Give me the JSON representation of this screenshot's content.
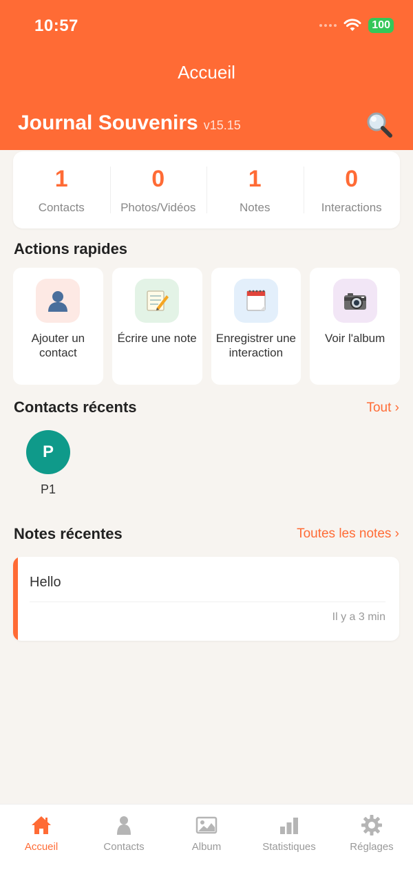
{
  "status_bar": {
    "time": "10:57",
    "battery": "100"
  },
  "header": {
    "nav_title": "Accueil",
    "app_title": "Journal Souvenirs",
    "version": "v15.15",
    "search_icon": "magnifier-icon"
  },
  "stats": [
    {
      "value": "1",
      "label": "Contacts"
    },
    {
      "value": "0",
      "label": "Photos/Vidéos"
    },
    {
      "value": "1",
      "label": "Notes"
    },
    {
      "value": "0",
      "label": "Interactions"
    }
  ],
  "quick_actions": {
    "title": "Actions rapides",
    "items": [
      {
        "label": "Ajouter un contact",
        "icon": "person-icon",
        "bg": "#fde9e4"
      },
      {
        "label": "Écrire une note",
        "icon": "memo-icon",
        "bg": "#e3f3e6"
      },
      {
        "label": "Enregistrer une interaction",
        "icon": "calendar-icon",
        "bg": "#e3effb"
      },
      {
        "label": "Voir l'album",
        "icon": "camera-icon",
        "bg": "#f2e6f6"
      }
    ]
  },
  "recent_contacts": {
    "title": "Contacts récents",
    "link": "Tout ›",
    "items": [
      {
        "initial": "P",
        "name": "P1",
        "color": "#0f9a8a"
      }
    ]
  },
  "recent_notes": {
    "title": "Notes récentes",
    "link": "Toutes les notes ›",
    "items": [
      {
        "text": "Hello",
        "time": "Il y a 3 min"
      }
    ]
  },
  "tabbar": [
    {
      "label": "Accueil",
      "icon": "home-icon",
      "active": true
    },
    {
      "label": "Contacts",
      "icon": "contacts-icon",
      "active": false
    },
    {
      "label": "Album",
      "icon": "image-icon",
      "active": false
    },
    {
      "label": "Statistiques",
      "icon": "bar-chart-icon",
      "active": false
    },
    {
      "label": "Réglages",
      "icon": "gear-icon",
      "active": false
    }
  ],
  "colors": {
    "accent": "#ff6b35",
    "background": "#f7f4f0",
    "battery": "#34c759"
  }
}
